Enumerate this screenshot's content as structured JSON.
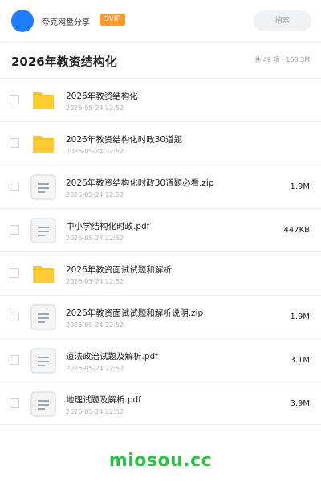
{
  "header": {
    "brand": "夸克网盘分享",
    "badge": "SVIP",
    "search_placeholder": "搜索"
  },
  "page": {
    "title": "2026年教资结构化",
    "summary": "共 49 项 · 168.3M"
  },
  "files": [
    {
      "name": "2026年教资结构化",
      "date": "2026-05-24 22:52",
      "size": "",
      "type": "folder"
    },
    {
      "name": "2026年教资结构化时政30道题",
      "date": "2026-05-24 22:52",
      "size": "",
      "type": "folder"
    },
    {
      "name": "2026年教资结构化时政30道题必看.zip",
      "date": "2026-05-24 22:52",
      "size": "1.9M",
      "type": "file"
    },
    {
      "name": "中小学结构化时政.pdf",
      "date": "2026-05-24 22:52",
      "size": "447KB",
      "type": "file"
    },
    {
      "name": "2026年教资面试试题和解析",
      "date": "2026-05-24 22:52",
      "size": "",
      "type": "folder"
    },
    {
      "name": "2026年教资面试试题和解析说明.zip",
      "date": "2026-05-24 22:52",
      "size": "1.9M",
      "type": "file"
    },
    {
      "name": "道法政治试题及解析.pdf",
      "date": "2026-05-24 22:52",
      "size": "3.1M",
      "type": "file"
    },
    {
      "name": "地理试题及解析.pdf",
      "date": "2026-05-24 22:52",
      "size": "3.9M",
      "type": "file"
    }
  ],
  "watermark": "miosou.cc",
  "colors": {
    "accent": "#1f7bff",
    "svip": "#ff9a2e",
    "folder": "#ffc21a",
    "watermark": "#2fbf4a"
  }
}
